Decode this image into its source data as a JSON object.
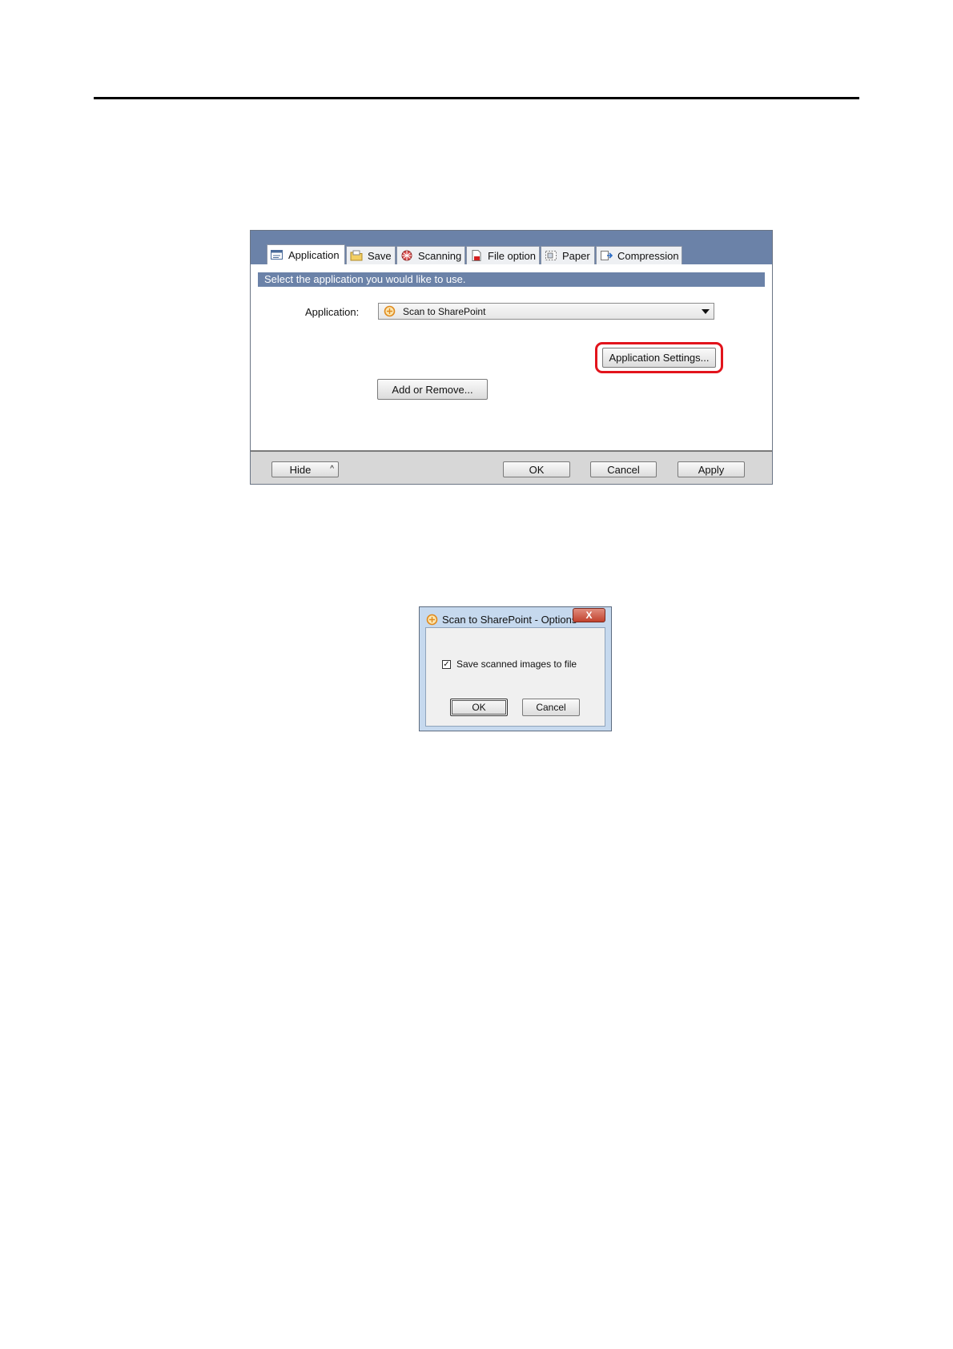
{
  "settings_window": {
    "tabs": [
      {
        "label": "Application",
        "icon": "application-tab-icon",
        "active": true
      },
      {
        "label": "Save",
        "icon": "save-folder-icon"
      },
      {
        "label": "Scanning",
        "icon": "scanning-icon"
      },
      {
        "label": "File option",
        "icon": "file-option-icon"
      },
      {
        "label": "Paper",
        "icon": "paper-icon"
      },
      {
        "label": "Compression",
        "icon": "compression-icon"
      }
    ],
    "instruction": "Select the application you would like to use.",
    "application_label": "Application:",
    "application_selected": "Scan to SharePoint",
    "application_settings_button": "Application Settings...",
    "add_remove_button": "Add or Remove...",
    "footer": {
      "hide": "Hide",
      "hide_chevron": "^",
      "ok": "OK",
      "cancel": "Cancel",
      "apply": "Apply"
    }
  },
  "options_dialog": {
    "title": "Scan to SharePoint - Options",
    "close": "X",
    "checkbox_label": "Save scanned images to file",
    "checkbox_checked": true,
    "checkbox_mark": "✓",
    "ok": "OK",
    "cancel": "Cancel"
  },
  "colors": {
    "window_header": "#6b82a8",
    "highlight": "#e2141c",
    "dialog_frame": "#c6d9ee"
  }
}
